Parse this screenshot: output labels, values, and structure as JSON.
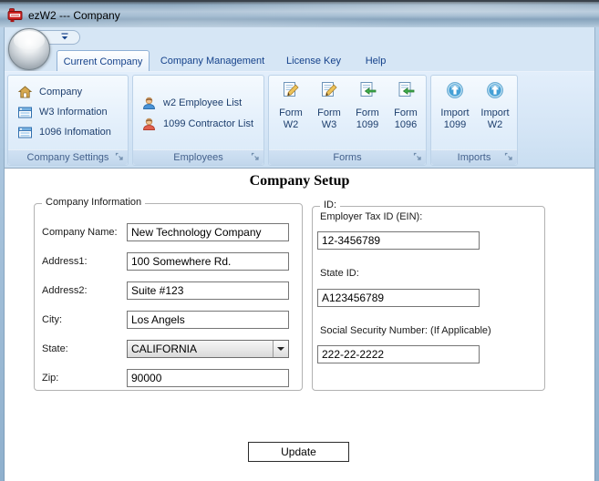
{
  "window": {
    "title": "ezW2 --- Company"
  },
  "tabs": [
    {
      "label": "Current Company",
      "active": true
    },
    {
      "label": "Company Management",
      "active": false
    },
    {
      "label": "License Key",
      "active": false
    },
    {
      "label": "Help",
      "active": false
    }
  ],
  "ribbon": {
    "groups": {
      "company_settings": {
        "label": "Company Settings",
        "items": [
          {
            "label": "Company",
            "icon": "home-icon"
          },
          {
            "label": "W3 Information",
            "icon": "form-list-icon"
          },
          {
            "label": "1096 Infomation",
            "icon": "form-list-icon"
          }
        ]
      },
      "employees": {
        "label": "Employees",
        "items": [
          {
            "label": "w2 Employee List",
            "icon": "person-blue-icon"
          },
          {
            "label": "1099 Contractor List",
            "icon": "person-red-icon"
          }
        ]
      },
      "forms": {
        "label": "Forms",
        "items": [
          {
            "line1": "Form",
            "line2": "W2",
            "icon": "doc-edit-icon"
          },
          {
            "line1": "Form",
            "line2": "W3",
            "icon": "doc-edit-icon"
          },
          {
            "line1": "Form",
            "line2": "1099",
            "icon": "doc-arrow-icon"
          },
          {
            "line1": "Form",
            "line2": "1096",
            "icon": "doc-arrow-icon"
          }
        ]
      },
      "imports": {
        "label": "Imports",
        "items": [
          {
            "line1": "Import",
            "line2": "1099",
            "icon": "import-up-icon"
          },
          {
            "line1": "Import",
            "line2": "W2",
            "icon": "import-up-icon"
          }
        ]
      }
    }
  },
  "main": {
    "heading": "Company Setup",
    "company_info": {
      "legend": "Company Information",
      "fields": [
        {
          "label": "Company Name:",
          "value": "New Technology Company"
        },
        {
          "label": "Address1:",
          "value": "100 Somewhere Rd."
        },
        {
          "label": "Address2:",
          "value": "Suite #123"
        },
        {
          "label": "City:",
          "value": "Los Angels"
        },
        {
          "label": "State:",
          "value": "CALIFORNIA"
        },
        {
          "label": "Zip:",
          "value": "90000"
        }
      ]
    },
    "ids": {
      "legend": "ID:",
      "fields": [
        {
          "label": "Employer Tax ID (EIN):",
          "value": "12-3456789"
        },
        {
          "label": "State ID:",
          "value": "A123456789"
        },
        {
          "label": "Social Security Number: (If Applicable)",
          "value": "222-22-2222"
        }
      ]
    },
    "update_button": "Update"
  },
  "colors": {
    "accent_blue": "#15428b",
    "ribbon_bg": "#d6e6f5",
    "group_border": "#bcd2e8",
    "app_icon_red": "#cc1f1f"
  }
}
